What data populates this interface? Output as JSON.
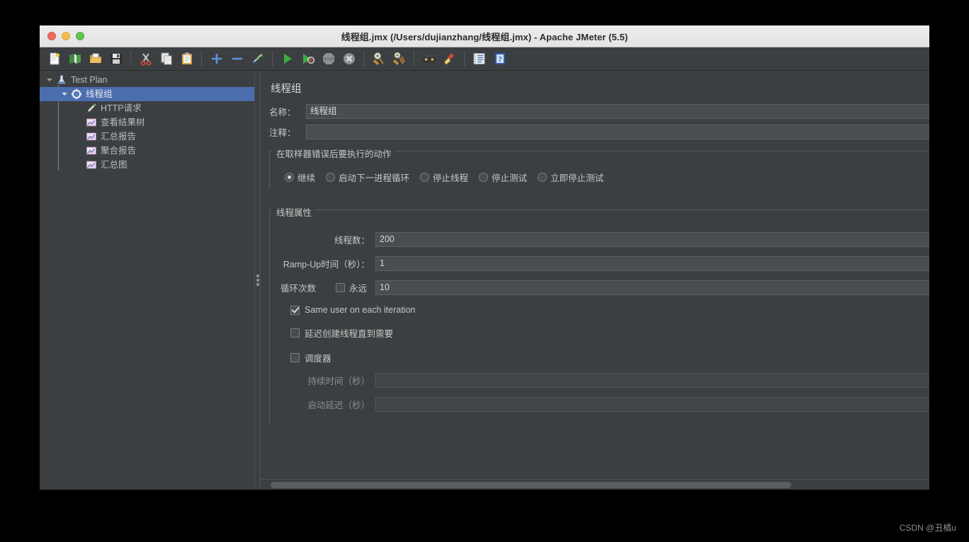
{
  "window": {
    "title": "线程组.jmx (/Users/dujianzhang/线程组.jmx) - Apache JMeter (5.5)",
    "controls": {
      "close": "close-button",
      "minimize": "minimize-button",
      "zoom": "zoom-button"
    }
  },
  "toolbar": {
    "buttons": [
      {
        "name": "new-icon",
        "tooltip": "New"
      },
      {
        "name": "templates-icon",
        "tooltip": "Templates"
      },
      {
        "name": "open-icon",
        "tooltip": "Open"
      },
      {
        "name": "save-icon",
        "tooltip": "Save Test Plan"
      },
      {
        "name": "cut-icon",
        "tooltip": "Cut"
      },
      {
        "name": "copy-icon",
        "tooltip": "Copy"
      },
      {
        "name": "paste-icon",
        "tooltip": "Paste"
      },
      {
        "name": "expand-all-icon",
        "tooltip": "Expand All"
      },
      {
        "name": "collapse-all-icon",
        "tooltip": "Collapse All"
      },
      {
        "name": "toggle-icon",
        "tooltip": "Toggle"
      },
      {
        "name": "start-icon",
        "tooltip": "Start"
      },
      {
        "name": "start-no-pauses-icon",
        "tooltip": "Start no pauses"
      },
      {
        "name": "stop-icon",
        "tooltip": "Stop"
      },
      {
        "name": "shutdown-icon",
        "tooltip": "Shutdown"
      },
      {
        "name": "clear-icon",
        "tooltip": "Clear"
      },
      {
        "name": "clear-all-icon",
        "tooltip": "Clear All"
      },
      {
        "name": "search-icon",
        "tooltip": "Search"
      },
      {
        "name": "reset-search-icon",
        "tooltip": "Reset Search"
      },
      {
        "name": "function-helper-icon",
        "tooltip": "Function Helper Dialog"
      },
      {
        "name": "help-icon",
        "tooltip": "Help"
      }
    ]
  },
  "tree": {
    "items": [
      {
        "label": "Test Plan",
        "icon": "test-plan-icon",
        "depth": 0,
        "expanded": true,
        "selected": false,
        "hasToggle": true
      },
      {
        "label": "线程组",
        "icon": "thread-group-icon",
        "depth": 1,
        "expanded": true,
        "selected": true,
        "hasToggle": true
      },
      {
        "label": "HTTP请求",
        "icon": "http-request-icon",
        "depth": 2,
        "expanded": false,
        "selected": false,
        "hasToggle": false
      },
      {
        "label": "查看结果树",
        "icon": "listener-icon",
        "depth": 2,
        "expanded": false,
        "selected": false,
        "hasToggle": false
      },
      {
        "label": "汇总报告",
        "icon": "listener-icon",
        "depth": 2,
        "expanded": false,
        "selected": false,
        "hasToggle": false
      },
      {
        "label": "聚合报告",
        "icon": "listener-icon",
        "depth": 2,
        "expanded": false,
        "selected": false,
        "hasToggle": false
      },
      {
        "label": "汇总图",
        "icon": "listener-icon",
        "depth": 2,
        "expanded": false,
        "selected": false,
        "hasToggle": false
      }
    ]
  },
  "main": {
    "panel_title": "线程组",
    "name_label": "名称：",
    "name_value": "线程组",
    "comment_label": "注释：",
    "comment_value": "",
    "error_action": {
      "legend": "在取样器错误后要执行的动作",
      "options": [
        {
          "label": "继续",
          "selected": true
        },
        {
          "label": "启动下一进程循环",
          "selected": false
        },
        {
          "label": "停止线程",
          "selected": false
        },
        {
          "label": "停止测试",
          "selected": false
        },
        {
          "label": "立即停止测试",
          "selected": false
        }
      ]
    },
    "thread_properties": {
      "legend": "线程属性",
      "num_threads_label": "线程数：",
      "num_threads_value": "200",
      "ramp_up_label": "Ramp-Up时间（秒）：",
      "ramp_up_value": "1",
      "loop_label": "循环次数",
      "forever_label": "永远",
      "forever_checked": false,
      "loop_value": "10",
      "same_user_label": "Same user on each iteration",
      "same_user_checked": true,
      "delayed_start_label": "延迟创建线程直到需要",
      "delayed_start_checked": false,
      "scheduler_label": "调度器",
      "scheduler_checked": false,
      "duration_label": "持续时间（秒）",
      "duration_value": "",
      "startup_delay_label": "启动延迟（秒）",
      "startup_delay_value": ""
    }
  },
  "watermark": "CSDN @丑橘u",
  "colors": {
    "window_bg": "#3c3f41",
    "selection": "#4b6eaf",
    "field_bg": "#4a4d4f",
    "text": "#c6c6c6",
    "titlebar_bg": "#e8e8e8"
  }
}
